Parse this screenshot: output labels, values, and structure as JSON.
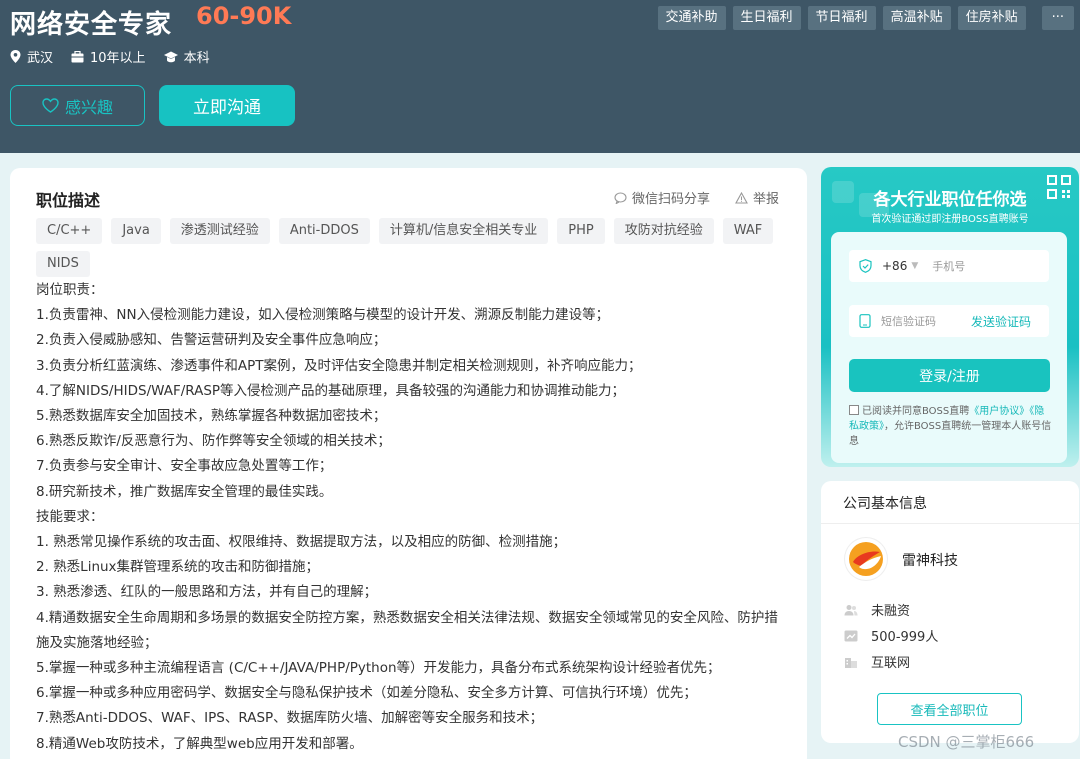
{
  "header": {
    "job_title": "网络安全专家",
    "salary": "60-90K",
    "city": "武汉",
    "experience": "10年以上",
    "education": "本科",
    "welfare": [
      "交通补助",
      "生日福利",
      "节日福利",
      "高温补贴",
      "住房补贴",
      "···"
    ],
    "interest_label": "感兴趣",
    "chat_label": "立即沟通"
  },
  "job": {
    "section_title": "职位描述",
    "share_label": "微信扫码分享",
    "report_label": "举报",
    "skills": [
      "C/C++",
      "Java",
      "渗透测试经验",
      "Anti-DDOS",
      "计算机/信息安全相关专业",
      "PHP",
      "攻防对抗经验",
      "WAF",
      "NIDS"
    ],
    "description": [
      "岗位职责：",
      "1.负责雷神、NN入侵检测能力建设，如入侵检测策略与模型的设计开发、溯源反制能力建设等；",
      "2.负责入侵威胁感知、告警运营研判及安全事件应急响应；",
      "3.负责分析红蓝演练、渗透事件和APT案例，及时评估安全隐患并制定相关检测规则，补齐响应能力；",
      "4.了解NIDS/HIDS/WAF/RASP等入侵检测产品的基础原理，具备较强的沟通能力和协调推动能力；",
      "5.熟悉数据库安全加固技术，熟练掌握各种数据加密技术；",
      "6.熟悉反欺诈/反恶意行为、防作弊等安全领域的相关技术；",
      "7.负责参与安全审计、安全事故应急处置等工作；",
      "8.研究新技术，推广数据库安全管理的最佳实践。",
      "技能要求：",
      "1. 熟悉常见操作系统的攻击面、权限维持、数据提取方法，以及相应的防御、检测措施；",
      "2. 熟悉Linux集群管理系统的攻击和防御措施；",
      "3. 熟悉渗透、红队的一般思路和方法，并有自己的理解；",
      "4.精通数据安全生命周期和多场景的数据安全防控方案，熟悉数据安全相关法律法规、数据安全领域常见的安全风险、防护措",
      "施及实施落地经验；",
      "5.掌握一种或多种主流编程语言 (C/C++/JAVA/PHP/Python等）开发能力，具备分布式系统架构设计经验者优先；",
      "6.掌握一种或多种应用密码学、数据安全与隐私保护技术（如差分隐私、安全多方计算、可信执行环境）优先；",
      "7.熟悉Anti-DDOS、WAF、IPS、RASP、数据库防火墙、加解密等安全服务和技术；",
      "8.精通Web攻防技术，了解典型web应用开发和部署。"
    ]
  },
  "login": {
    "title": "各大行业职位任你选",
    "subtitle": "首次验证通过即注册BOSS直聘账号",
    "country_code": "+86",
    "phone_placeholder": "手机号",
    "code_placeholder": "短信验证码",
    "send_code": "发送验证码",
    "submit": "登录/注册",
    "agree_text_1": "已阅读并同意BOSS直聘",
    "agree_link_1": "《用户协议》",
    "agree_link_2": "《隐私政策》",
    "agree_text_2": "，允许BOSS直聘统一管理本人账号信息",
    "accent_color": "#19c3bf"
  },
  "company": {
    "section_title": "公司基本信息",
    "name": "雷神科技",
    "financing": "未融资",
    "size": "500-999人",
    "industry": "互联网",
    "view_all": "查看全部职位"
  },
  "watermark": "CSDN @三掌柜666"
}
